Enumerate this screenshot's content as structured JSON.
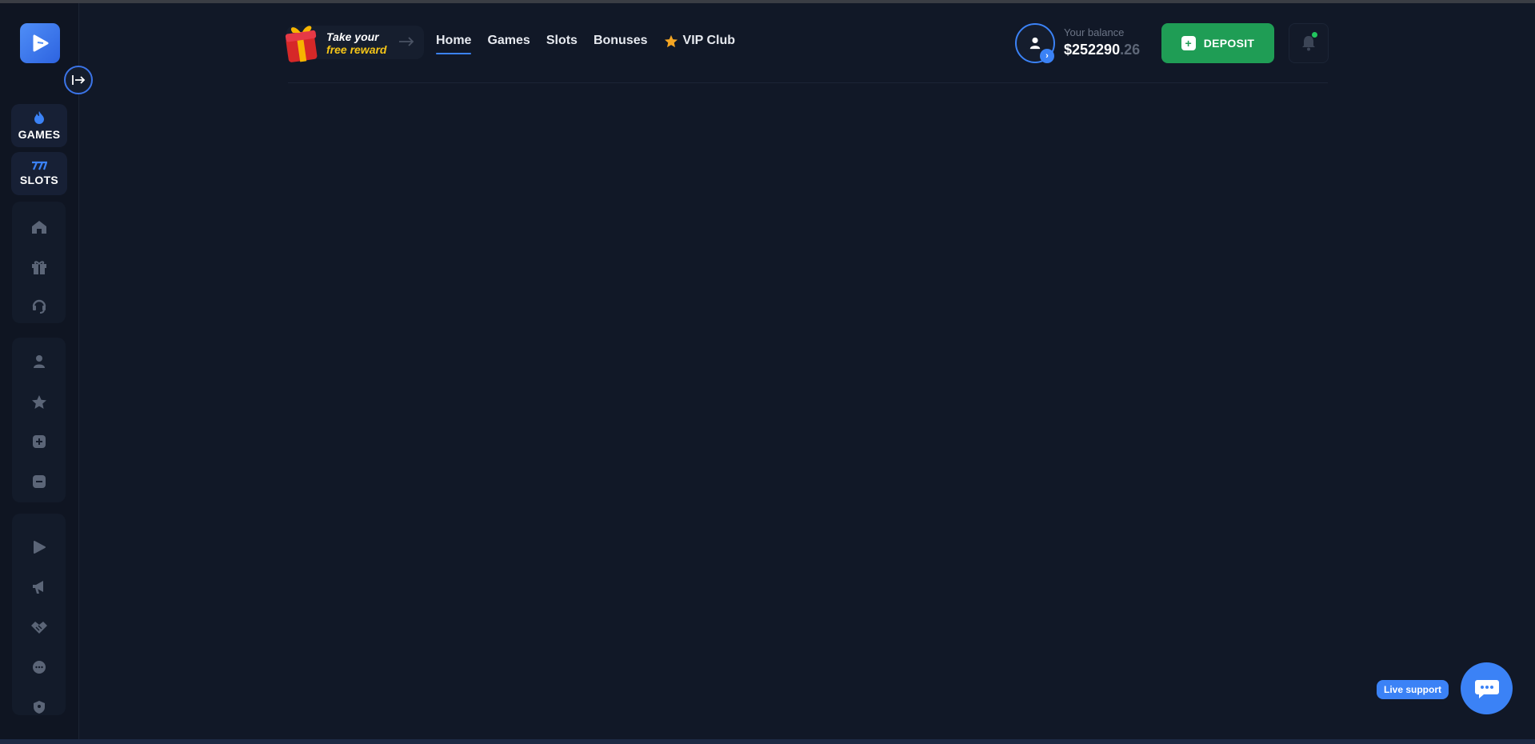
{
  "sidebar": {
    "logo_icon": "play-logo-icon",
    "collapse_icon": "collapse-arrow-icon",
    "categories": [
      {
        "label": "GAMES",
        "icon": "flame-icon"
      },
      {
        "label": "SLOTS",
        "icon": "sevens-icon"
      }
    ],
    "group1": [
      "home-icon",
      "gift-icon",
      "support-headset-icon"
    ],
    "group2": [
      "user-icon",
      "star-icon",
      "plus-square-icon",
      "minus-square-icon"
    ],
    "group3": [
      "play-icon",
      "megaphone-icon",
      "handshake-icon",
      "chat-icon",
      "shield-icon"
    ]
  },
  "header": {
    "reward": {
      "line1": "Take your",
      "line2": "free reward"
    },
    "nav": [
      {
        "label": "Home",
        "active": true
      },
      {
        "label": "Games"
      },
      {
        "label": "Slots"
      },
      {
        "label": "Bonuses"
      },
      {
        "label": "VIP Club"
      }
    ],
    "balance_label": "Your balance",
    "balance_main": "$252290",
    "balance_cents": ".26",
    "deposit_label": "DEPOSIT"
  },
  "support": {
    "label": "Live support"
  },
  "colors": {
    "background": "#111827",
    "accent": "#3b82f6",
    "deposit": "#1f9d55",
    "reward_text": "#f5c518"
  }
}
